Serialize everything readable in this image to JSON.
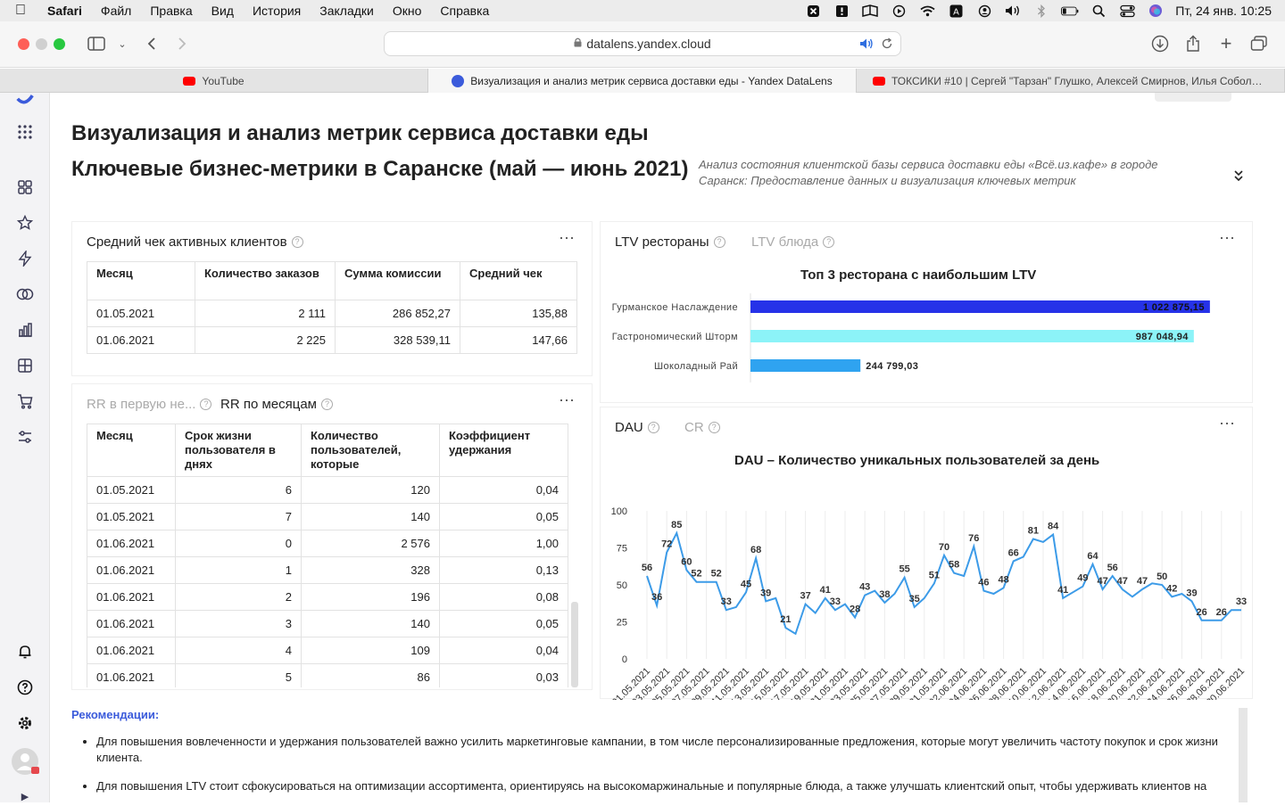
{
  "menubar": {
    "app": "Safari",
    "items": [
      "Файл",
      "Правка",
      "Вид",
      "История",
      "Закладки",
      "Окно",
      "Справка"
    ],
    "clock": "Пт, 24 янв.  10:25"
  },
  "browser": {
    "url": "datalens.yandex.cloud",
    "tabs": [
      {
        "label": "YouTube"
      },
      {
        "label": "Визуализация и анализ метрик сервиса доставки еды - Yandex DataLens"
      },
      {
        "label": "ТОКСИКИ #10 | Сергей \"Тарзан\" Глушко, Алексей Смирнов, Илья Соболев..."
      }
    ]
  },
  "dashboard": {
    "title": "Визуализация и анализ метрик сервиса доставки еды",
    "subtitle": "Ключевые бизнес-метрики в Саранске (май — июнь 2021)",
    "description": "Анализ состояния клиентской базы сервиса доставки еды «Всё.из.кафе» в городе Саранск: Предоставление данных и визуализация ключевых метрик"
  },
  "avg_check": {
    "title": "Средний чек активных клиентов",
    "columns": [
      "Месяц",
      "Количество заказов",
      "Сумма комиссии",
      "Средний чек"
    ],
    "rows": [
      [
        "01.05.2021",
        "2 111",
        "286 852,27",
        "135,88"
      ],
      [
        "01.06.2021",
        "2 225",
        "328 539,11",
        "147,66"
      ]
    ]
  },
  "ltv": {
    "tab_active": "LTV рестораны",
    "tab_inactive": "LTV блюда",
    "chart_title": "Топ 3 ресторана с наибольшим LTV"
  },
  "rr": {
    "tab_inactive": "RR в первую не...",
    "tab_active": "RR по месяцам",
    "columns": [
      "Месяц",
      "Срок жизни пользователя в днях",
      "Количество пользователей, которые",
      "Коэффициент удержания"
    ],
    "rows": [
      [
        "01.05.2021",
        "6",
        "120",
        "0,04"
      ],
      [
        "01.05.2021",
        "7",
        "140",
        "0,05"
      ],
      [
        "01.06.2021",
        "0",
        "2 576",
        "1,00"
      ],
      [
        "01.06.2021",
        "1",
        "328",
        "0,13"
      ],
      [
        "01.06.2021",
        "2",
        "196",
        "0,08"
      ],
      [
        "01.06.2021",
        "3",
        "140",
        "0,05"
      ],
      [
        "01.06.2021",
        "4",
        "109",
        "0,04"
      ],
      [
        "01.06.2021",
        "5",
        "86",
        "0,03"
      ]
    ]
  },
  "dau": {
    "tab_active": "DAU",
    "tab_inactive": "CR",
    "chart_title": "DAU – Количество уникальных пользователей за день"
  },
  "recommendations": {
    "heading": "Рекомендации",
    "items": [
      "Для повышения вовлеченности и удержания пользователей важно усилить маркетинговые кампании, в том числе персонализированные предложения, которые могут увеличить частоту покупок и срок жизни клиента.",
      "Для повышения LTV стоит сфокусироваться на оптимизации ассортимента, ориентируясь на высокомаржинальные и популярные блюда, а также улучшать клиентский опыт, чтобы удерживать клиентов на"
    ]
  },
  "colors": {
    "accent": "#3b5bdb",
    "line": "#3c9be8",
    "bar1": "#2632e8",
    "bar2": "#8cf3f8",
    "bar3": "#2fa3f0"
  },
  "chart_data": [
    {
      "type": "bar",
      "orientation": "horizontal",
      "title": "Топ 3 ресторана с наибольшим LTV",
      "categories": [
        "Гурманское Наслаждение",
        "Гастрономический Шторм",
        "Шоколадный Рай"
      ],
      "values": [
        1022875.15,
        987048.94,
        244799.03
      ],
      "labels": [
        "1 022 875,15",
        "987 048,94",
        "244 799,03"
      ],
      "colors": [
        "#2632e8",
        "#8cf3f8",
        "#2fa3f0"
      ]
    },
    {
      "type": "line",
      "title": "DAU – Количество уникальных пользователей за день",
      "ylim": [
        0,
        100
      ],
      "yticks": [
        0,
        25,
        50,
        75,
        100
      ],
      "x": [
        "01.05.2021",
        "02.05.2021",
        "03.05.2021",
        "04.05.2021",
        "05.05.2021",
        "06.05.2021",
        "07.05.2021",
        "08.05.2021",
        "09.05.2021",
        "10.05.2021",
        "11.05.2021",
        "12.05.2021",
        "13.05.2021",
        "14.05.2021",
        "15.05.2021",
        "16.05.2021",
        "17.05.2021",
        "18.05.2021",
        "19.05.2021",
        "20.05.2021",
        "21.05.2021",
        "22.05.2021",
        "23.05.2021",
        "24.05.2021",
        "25.05.2021",
        "26.05.2021",
        "27.05.2021",
        "28.05.2021",
        "29.05.2021",
        "30.05.2021",
        "31.05.2021",
        "01.06.2021",
        "02.06.2021",
        "03.06.2021",
        "04.06.2021",
        "05.06.2021",
        "06.06.2021",
        "07.06.2021",
        "08.06.2021",
        "09.06.2021",
        "10.06.2021",
        "11.06.2021",
        "12.06.2021",
        "13.06.2021",
        "14.06.2021",
        "15.06.2021",
        "16.06.2021",
        "17.06.2021",
        "18.06.2021",
        "19.06.2021",
        "20.06.2021",
        "21.06.2021",
        "22.06.2021",
        "23.06.2021",
        "24.06.2021",
        "25.06.2021",
        "26.06.2021",
        "27.06.2021",
        "28.06.2021",
        "29.06.2021",
        "30.06.2021"
      ],
      "xticks": [
        "01.05.2021",
        "03.05.2021",
        "05.05.2021",
        "07.05.2021",
        "09.05.2021",
        "11.05.2021",
        "13.05.2021",
        "15.05.2021",
        "17.05.2021",
        "19.05.2021",
        "21.05.2021",
        "23.05.2021",
        "25.05.2021",
        "27.05.2021",
        "29.05.2021",
        "31.05.2021",
        "02.06.2021",
        "04.06.2021",
        "06.06.2021",
        "08.06.2021",
        "10.06.2021",
        "12.06.2021",
        "14.06.2021",
        "16.06.2021",
        "18.06.2021",
        "20.06.2021",
        "22.06.2021",
        "24.06.2021",
        "26.06.2021",
        "28.06.2021",
        "30.06.2021"
      ],
      "values": [
        56,
        36,
        72,
        85,
        60,
        52,
        52,
        52,
        33,
        35,
        45,
        68,
        39,
        41,
        21,
        17,
        37,
        31,
        41,
        33,
        37,
        28,
        43,
        46,
        38,
        44,
        55,
        35,
        41,
        51,
        70,
        58,
        56,
        76,
        46,
        44,
        48,
        66,
        69,
        81,
        79,
        84,
        41,
        45,
        49,
        64,
        47,
        56,
        47,
        42,
        47,
        51,
        50,
        42,
        44,
        39,
        26,
        26,
        26,
        33,
        33
      ],
      "labeled_points": [
        [
          0,
          56
        ],
        [
          1,
          36
        ],
        [
          2,
          72
        ],
        [
          3,
          85
        ],
        [
          4,
          60
        ],
        [
          5,
          52
        ],
        [
          7,
          52
        ],
        [
          8,
          33
        ],
        [
          10,
          45
        ],
        [
          11,
          68
        ],
        [
          12,
          39
        ],
        [
          14,
          21
        ],
        [
          16,
          37
        ],
        [
          18,
          41
        ],
        [
          19,
          33
        ],
        [
          21,
          28
        ],
        [
          22,
          43
        ],
        [
          24,
          38
        ],
        [
          26,
          55
        ],
        [
          27,
          35
        ],
        [
          29,
          51
        ],
        [
          30,
          70
        ],
        [
          31,
          58
        ],
        [
          33,
          76
        ],
        [
          34,
          46
        ],
        [
          36,
          48
        ],
        [
          37,
          66
        ],
        [
          39,
          81
        ],
        [
          41,
          84
        ],
        [
          42,
          41
        ],
        [
          44,
          49
        ],
        [
          45,
          64
        ],
        [
          46,
          47
        ],
        [
          47,
          56
        ],
        [
          48,
          47
        ],
        [
          50,
          47
        ],
        [
          52,
          50
        ],
        [
          53,
          42
        ],
        [
          55,
          39
        ],
        [
          56,
          26
        ],
        [
          58,
          26
        ],
        [
          60,
          33
        ]
      ]
    }
  ]
}
